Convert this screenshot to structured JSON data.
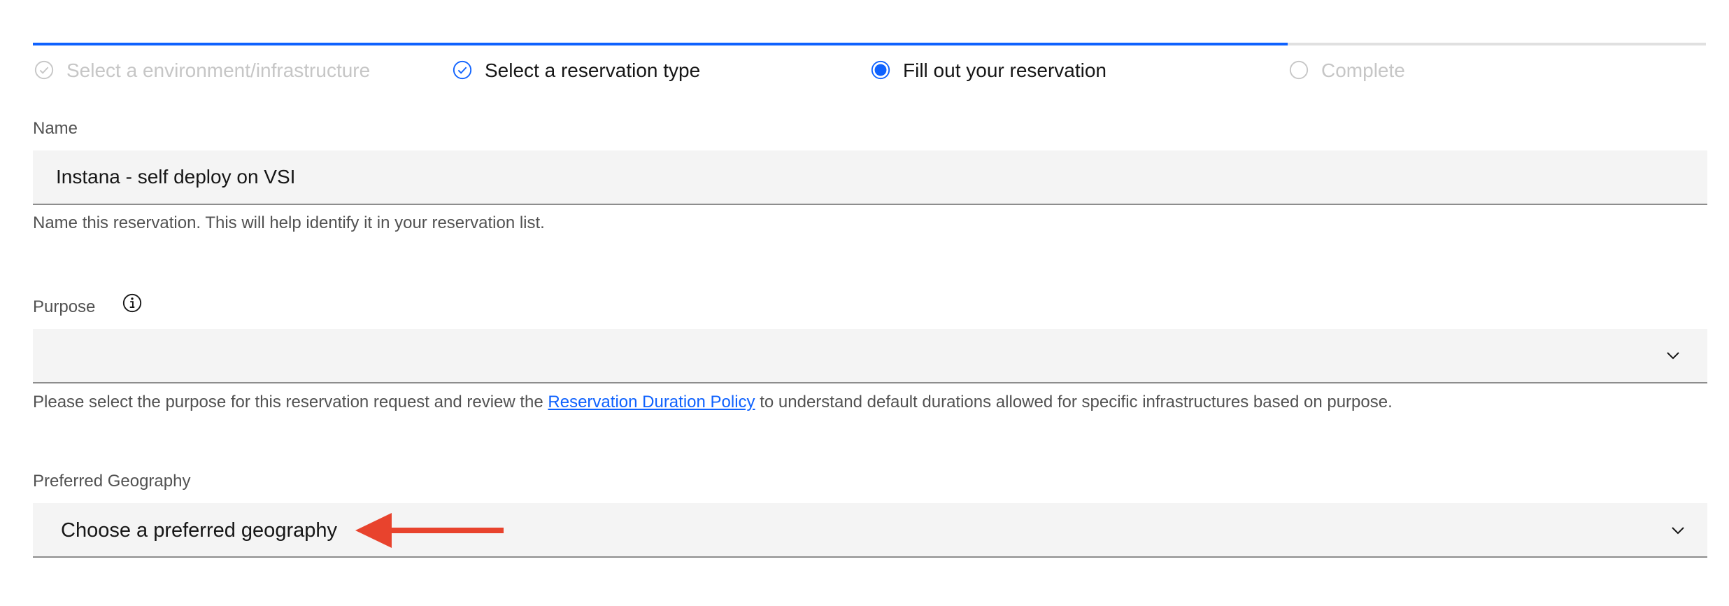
{
  "progress": {
    "steps": [
      {
        "label": "Select a environment/infrastructure",
        "state": "complete-muted"
      },
      {
        "label": "Select a reservation type",
        "state": "complete"
      },
      {
        "label": "Fill out your reservation",
        "state": "current"
      },
      {
        "label": "Complete",
        "state": "incomplete"
      }
    ],
    "colors": {
      "accent": "#0f62fe",
      "inactive": "#e0e0e0",
      "muted_text": "#c6c6c6"
    },
    "icons": {
      "complete": "checkmark-outline-icon",
      "current": "radio-current-icon",
      "incomplete": "circle-outline-icon"
    }
  },
  "form": {
    "name": {
      "label": "Name",
      "value": "Instana - self deploy on VSI",
      "helper": "Name this reservation. This will help identify it in your reservation list."
    },
    "purpose": {
      "label": "Purpose",
      "info_icon": "information-icon",
      "value": "",
      "helper_before": "Please select the purpose for this reservation request and review the ",
      "helper_link": "Reservation Duration Policy",
      "helper_after": " to understand default durations allowed for specific infrastructures based on purpose."
    },
    "geography": {
      "label": "Preferred Geography",
      "placeholder": "Choose a preferred geography"
    }
  },
  "annotation": {
    "arrow_icon": "red-arrow-left-icon",
    "color": "#e8432d"
  }
}
